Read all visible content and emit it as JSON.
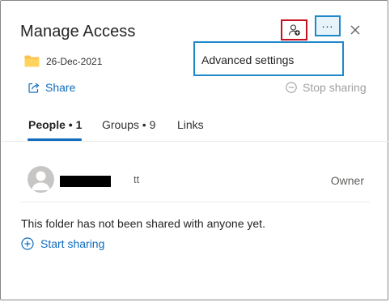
{
  "dialog": {
    "title": "Manage Access",
    "folder_date": "26-Dec-2021",
    "share_label": "Share",
    "stop_sharing_label": "Stop sharing"
  },
  "menu": {
    "more_label": "...",
    "items": [
      {
        "label": "Advanced settings"
      }
    ]
  },
  "tabs": [
    {
      "label": "People • 1",
      "active": true
    },
    {
      "label": "Groups • 9",
      "active": false
    },
    {
      "label": "Links",
      "active": false
    }
  ],
  "people": [
    {
      "name_visible_fragment": "tt",
      "role": "Owner"
    }
  ],
  "empty_state": {
    "message": "This folder has not been shared with anyone yet.",
    "start_sharing_label": "Start sharing"
  },
  "icons": {
    "add_people": "add-people-icon",
    "more": "more-options-icon",
    "close": "close-icon",
    "folder": "folder-icon",
    "share": "share-icon",
    "stop_sharing": "stop-sharing-icon",
    "start_sharing": "plus-circle-icon",
    "avatar": "person-avatar-icon"
  },
  "colors": {
    "accent": "#0f6cbd",
    "highlight_red": "#c50f1f",
    "highlight_blue": "#1e88c9",
    "folder": "#f8c24c",
    "disabled_text": "#a19f9d"
  }
}
